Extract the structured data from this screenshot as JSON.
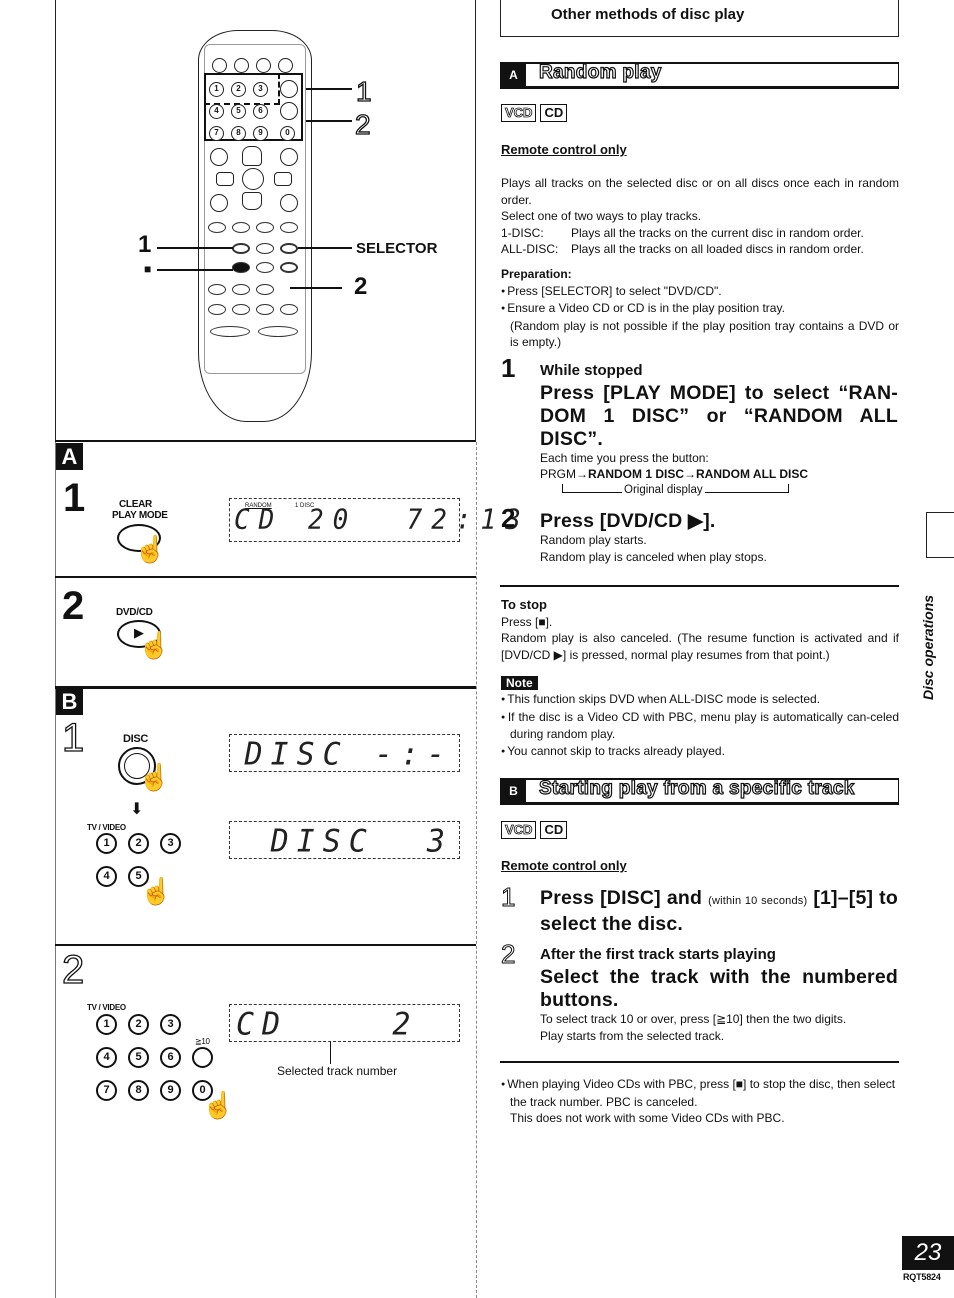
{
  "header": {
    "title": "Other methods of disc play"
  },
  "side_tab": {
    "label": "Disc operations"
  },
  "footer": {
    "page_number": "23",
    "doc_code": "RQT5824"
  },
  "remote_illustration": {
    "callouts": {
      "top_1": "1",
      "top_2": "2",
      "left_1": "1",
      "left_stop": "■",
      "selector": "SELECTOR",
      "right_2": "2"
    },
    "number_buttons": [
      "1",
      "2",
      "3",
      "4",
      "5",
      "6",
      "7",
      "8",
      "9",
      "0"
    ]
  },
  "left_panel_a": {
    "section_letter": "A",
    "step1": {
      "number": "1",
      "button_label_1": "CLEAR",
      "button_label_2": "PLAY MODE",
      "display": {
        "indicator_1": "RANDOM",
        "indicator_2": "1 DISC",
        "text": "CD 20  72:13"
      }
    },
    "step2": {
      "number": "2",
      "button_label": "DVD/CD",
      "button_glyph": "▶"
    }
  },
  "left_panel_b": {
    "section_letter": "B",
    "step1": {
      "number": "1",
      "button_label": "DISC",
      "arrow": "⬇",
      "numpad_label": "TV / VIDEO",
      "numpad": [
        "1",
        "2",
        "3",
        "4",
        "5"
      ],
      "display_1": "DISC -:-",
      "display_2": "DISC  3"
    },
    "step2": {
      "number": "2",
      "numpad_label": "TV / VIDEO",
      "numpad": [
        "1",
        "2",
        "3",
        "4",
        "5",
        "6",
        "7",
        "8",
        "9",
        "0"
      ],
      "ge10_label": "≧10",
      "display": "CD    2",
      "display_caption": "Selected track number"
    }
  },
  "section_a": {
    "tag": "A",
    "title": "Random play",
    "badges": [
      "VCD",
      "CD"
    ],
    "remote_only": "Remote control only",
    "intro": [
      "Plays all tracks on the selected disc or on all discs once each in random order.",
      "Select one of two ways to play tracks."
    ],
    "modes": [
      {
        "key": "1-DISC:",
        "desc": "Plays all the tracks on the current disc in random order."
      },
      {
        "key": "ALL-DISC:",
        "desc": "Plays all the tracks on all loaded discs in random order."
      }
    ],
    "preparation_title": "Preparation:",
    "preparation": [
      "Press [SELECTOR] to select \"DVD/CD\".",
      "Ensure a Video CD or CD is in the play position tray."
    ],
    "preparation_note": "(Random play is not possible if the play position tray contains a DVD or is empty.)",
    "step1": {
      "number": "1",
      "sub": "While stopped",
      "main": "Press [PLAY MODE] to select “RAN-DOM 1 DISC” or “RANDOM ALL DISC”.",
      "detail": "Each time you press the button:",
      "sequence": {
        "a": "PRGM",
        "b": "RANDOM 1 DISC",
        "c": "RANDOM ALL DISC",
        "back": "Original display"
      }
    },
    "step2": {
      "number": "2",
      "main": "Press [DVD/CD ▶].",
      "detail": [
        "Random play starts.",
        "Random play is canceled when play stops."
      ]
    },
    "to_stop": {
      "title": "To stop",
      "line1": "Press [■].",
      "line2": "Random play is also canceled. (The resume function is activated and if [DVD/CD ▶] is pressed, normal play resumes from that point.)"
    },
    "note": {
      "tag": "Note",
      "items": [
        "This function skips DVD when ALL-DISC mode is selected.",
        "If the disc is a Video CD with PBC, menu play is automatically can-celed during random play.",
        "You cannot skip to tracks already played."
      ]
    }
  },
  "section_b": {
    "tag": "B",
    "title": "Starting play from a specific track",
    "badges": [
      "VCD",
      "CD"
    ],
    "remote_only": "Remote control only",
    "step1": {
      "number": "1",
      "main_a": "Press [DISC] and",
      "main_small": "(within 10 seconds)",
      "main_b": "[1]–[5] to select the disc."
    },
    "step2": {
      "number": "2",
      "sub": "After the first track starts playing",
      "main": "Select the track with the numbered buttons.",
      "detail": [
        "To select track 10 or over, press [≧10] then the two digits.",
        "Play starts from the selected track."
      ]
    },
    "footnote": {
      "line1": "When playing Video CDs with PBC, press [■] to stop the disc, then select the track number. PBC is canceled.",
      "line2": "This does not work with some Video CDs with PBC."
    }
  }
}
